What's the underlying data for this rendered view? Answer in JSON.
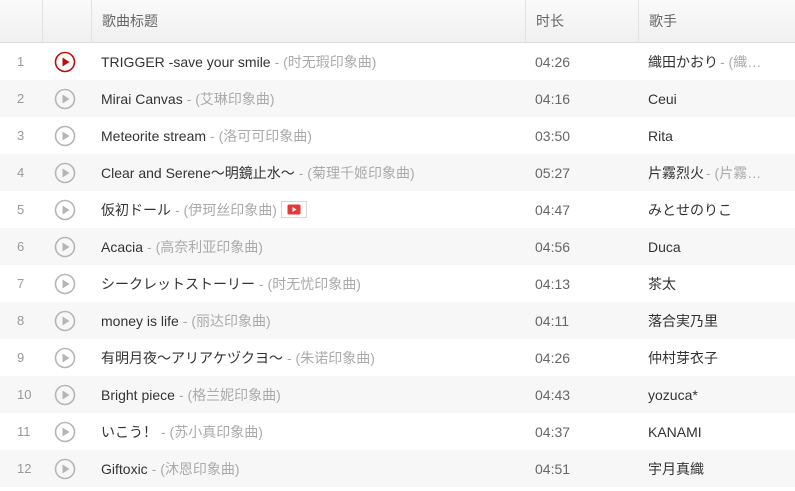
{
  "columns": {
    "title": "歌曲标题",
    "duration": "时长",
    "artist": "歌手"
  },
  "colors": {
    "active_play": "#c20c0c",
    "play": "#b5b5b5",
    "alias": "#aaaaaa"
  },
  "songs": [
    {
      "index": "1",
      "title": "TRIGGER -save your smile",
      "alias": "- (时无瑕印象曲)",
      "duration": "04:26",
      "artist": "織田かおり",
      "artist_alias": "- (織…",
      "active": true,
      "mv": false
    },
    {
      "index": "2",
      "title": "Mirai Canvas",
      "alias": "- (艾琳印象曲)",
      "duration": "04:16",
      "artist": "Ceui",
      "artist_alias": "",
      "active": false,
      "mv": false
    },
    {
      "index": "3",
      "title": "Meteorite stream",
      "alias": "- (洛可可印象曲)",
      "duration": "03:50",
      "artist": "Rita",
      "artist_alias": "",
      "active": false,
      "mv": false
    },
    {
      "index": "4",
      "title": "Clear and Serene～明鏡止水～",
      "alias": "- (菊理千姬印象曲)",
      "duration": "05:27",
      "artist": "片霧烈火",
      "artist_alias": "- (片霧…",
      "active": false,
      "mv": false
    },
    {
      "index": "5",
      "title": "仮初ドール",
      "alias": "- (伊珂丝印象曲)",
      "duration": "04:47",
      "artist": "みとせのりこ",
      "artist_alias": "",
      "active": false,
      "mv": true
    },
    {
      "index": "6",
      "title": "Acacia",
      "alias": "- (高奈利亚印象曲)",
      "duration": "04:56",
      "artist": "Duca",
      "artist_alias": "",
      "active": false,
      "mv": false
    },
    {
      "index": "7",
      "title": "シークレットストーリー",
      "alias": "- (时无忧印象曲)",
      "duration": "04:13",
      "artist": "茶太",
      "artist_alias": "",
      "active": false,
      "mv": false
    },
    {
      "index": "8",
      "title": "money is life",
      "alias": "- (丽达印象曲)",
      "duration": "04:11",
      "artist": "落合実乃里",
      "artist_alias": "",
      "active": false,
      "mv": false
    },
    {
      "index": "9",
      "title": "有明月夜～アリアケヅクヨ～",
      "alias": "- (朱诺印象曲)",
      "duration": "04:26",
      "artist": "仲村芽衣子",
      "artist_alias": "",
      "active": false,
      "mv": false
    },
    {
      "index": "10",
      "title": "Bright piece",
      "alias": "- (格兰妮印象曲)",
      "duration": "04:43",
      "artist": "yozuca*",
      "artist_alias": "",
      "active": false,
      "mv": false
    },
    {
      "index": "11",
      "title": "いこう！",
      "alias": "- (苏小真印象曲)",
      "duration": "04:37",
      "artist": "KANAMI",
      "artist_alias": "",
      "active": false,
      "mv": false
    },
    {
      "index": "12",
      "title": "Giftoxic",
      "alias": "- (沐恩印象曲)",
      "duration": "04:51",
      "artist": "宇月真織",
      "artist_alias": "",
      "active": false,
      "mv": false
    }
  ]
}
